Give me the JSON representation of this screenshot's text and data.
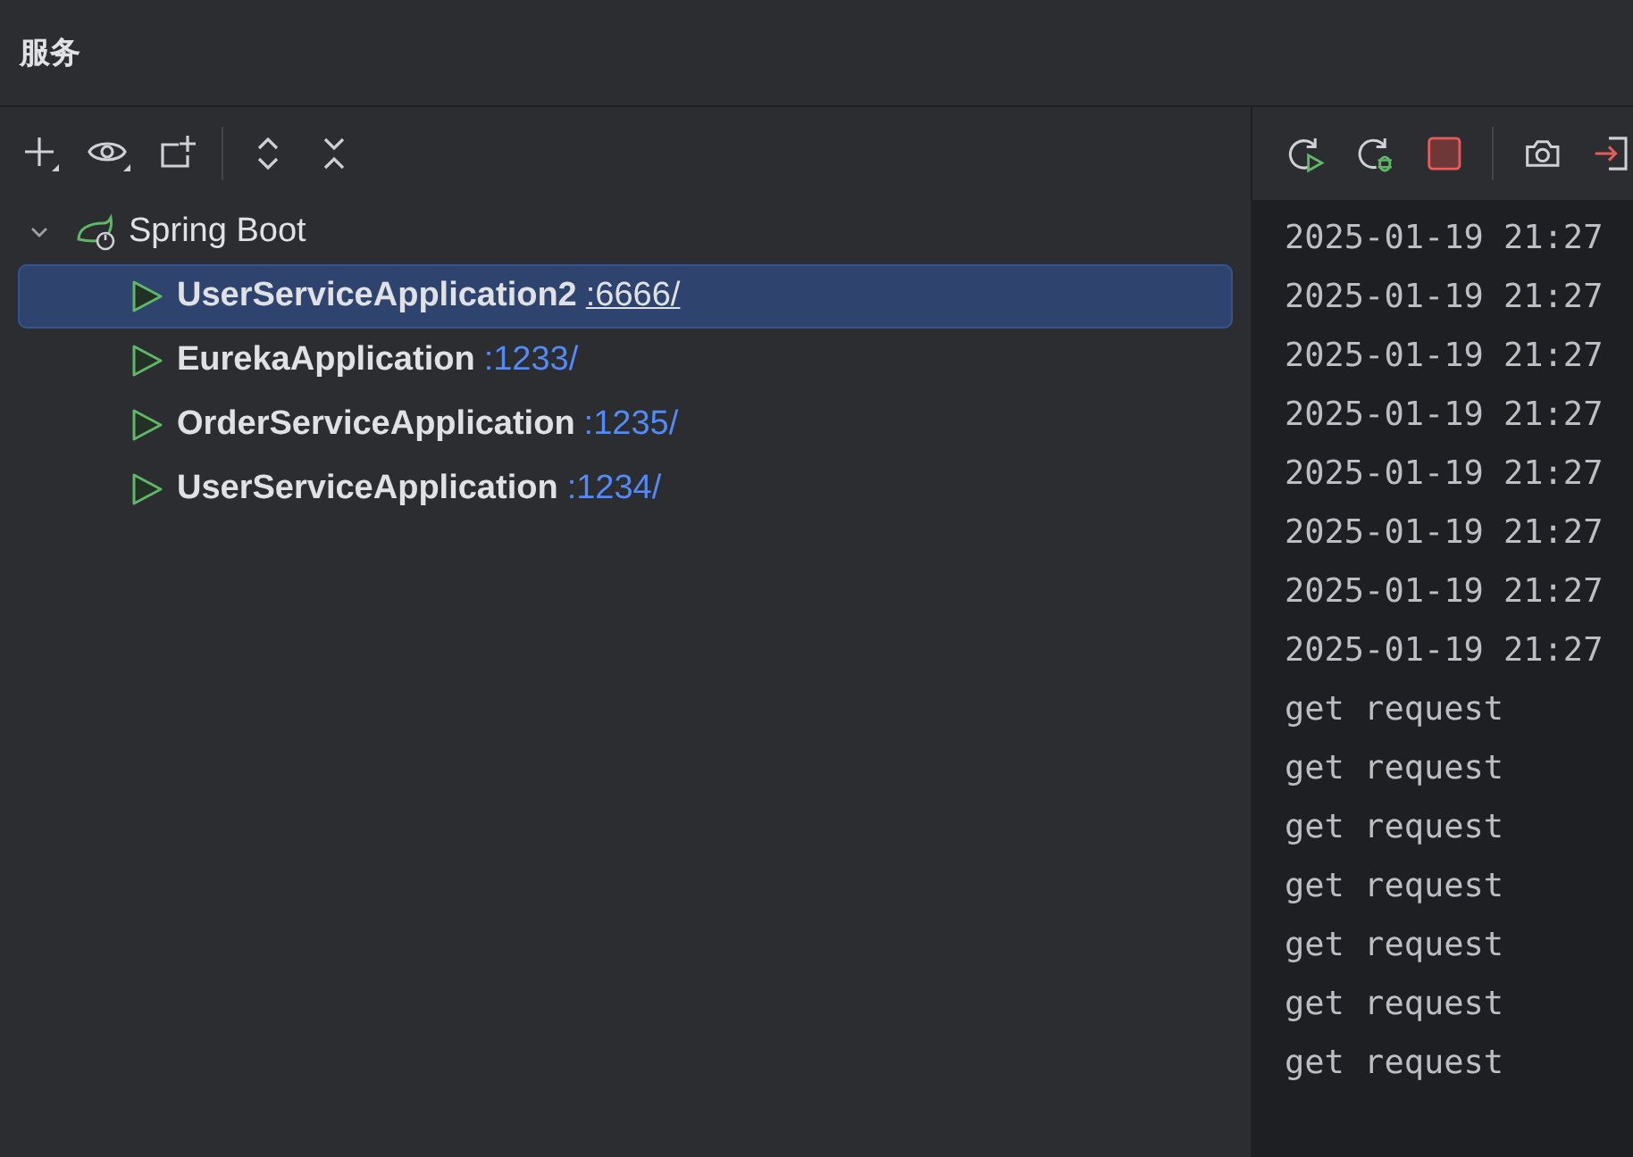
{
  "header": {
    "title": "服务"
  },
  "tree": {
    "label": "Spring Boot",
    "expanded": true,
    "children": [
      {
        "name": "UserServiceApplication2",
        "port": ":6666/",
        "selected": true
      },
      {
        "name": "EurekaApplication",
        "port": ":1233/",
        "selected": false
      },
      {
        "name": "OrderServiceApplication",
        "port": ":1235/",
        "selected": false
      },
      {
        "name": "UserServiceApplication",
        "port": ":1234/",
        "selected": false
      }
    ]
  },
  "console": {
    "lines": [
      "2025-01-19 21:27",
      "2025-01-19 21:27",
      "2025-01-19 21:27",
      "2025-01-19 21:27",
      "2025-01-19 21:27",
      "2025-01-19 21:27",
      "2025-01-19 21:27",
      "2025-01-19 21:27",
      "get request",
      "get request",
      "get request",
      "get request",
      "get request",
      "get request",
      "get request"
    ]
  }
}
